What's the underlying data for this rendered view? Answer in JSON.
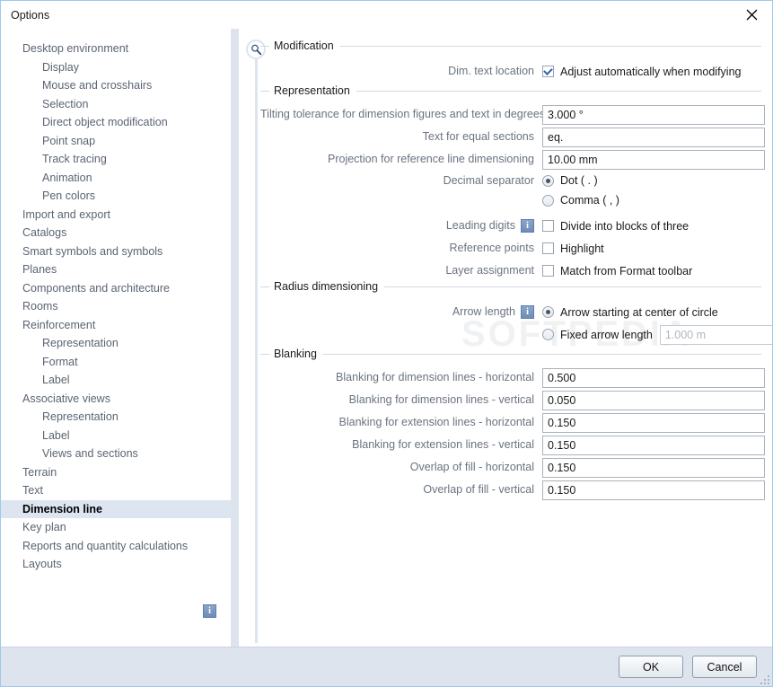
{
  "window": {
    "title": "Options",
    "close_icon": "close-icon"
  },
  "sidebar": {
    "info_icon": "info-icon",
    "items": [
      {
        "label": "Desktop environment",
        "level": 0,
        "selected": false
      },
      {
        "label": "Display",
        "level": 1,
        "selected": false
      },
      {
        "label": "Mouse and crosshairs",
        "level": 1,
        "selected": false
      },
      {
        "label": "Selection",
        "level": 1,
        "selected": false
      },
      {
        "label": "Direct object modification",
        "level": 1,
        "selected": false
      },
      {
        "label": "Point snap",
        "level": 1,
        "selected": false
      },
      {
        "label": "Track tracing",
        "level": 1,
        "selected": false
      },
      {
        "label": "Animation",
        "level": 1,
        "selected": false
      },
      {
        "label": "Pen colors",
        "level": 1,
        "selected": false
      },
      {
        "label": "Import and export",
        "level": 0,
        "selected": false
      },
      {
        "label": "Catalogs",
        "level": 0,
        "selected": false
      },
      {
        "label": "Smart symbols and symbols",
        "level": 0,
        "selected": false
      },
      {
        "label": "Planes",
        "level": 0,
        "selected": false
      },
      {
        "label": "Components and architecture",
        "level": 0,
        "selected": false
      },
      {
        "label": "Rooms",
        "level": 0,
        "selected": false
      },
      {
        "label": "Reinforcement",
        "level": 0,
        "selected": false
      },
      {
        "label": "Representation",
        "level": 1,
        "selected": false
      },
      {
        "label": "Format",
        "level": 1,
        "selected": false
      },
      {
        "label": "Label",
        "level": 1,
        "selected": false
      },
      {
        "label": "Associative views",
        "level": 0,
        "selected": false
      },
      {
        "label": "Representation",
        "level": 1,
        "selected": false
      },
      {
        "label": "Label",
        "level": 1,
        "selected": false
      },
      {
        "label": "Views and sections",
        "level": 1,
        "selected": false
      },
      {
        "label": "Terrain",
        "level": 0,
        "selected": false
      },
      {
        "label": "Text",
        "level": 0,
        "selected": false
      },
      {
        "label": "Dimension line",
        "level": 0,
        "selected": true
      },
      {
        "label": "Key plan",
        "level": 0,
        "selected": false
      },
      {
        "label": "Reports and quantity calculations",
        "level": 0,
        "selected": false
      },
      {
        "label": "Layouts",
        "level": 0,
        "selected": false
      }
    ]
  },
  "content": {
    "watermark": "SOFTPEDIA",
    "magnifier_icon": "magnifier-icon",
    "groups": {
      "modification": {
        "title": "Modification",
        "dim_text_location_label": "Dim. text location",
        "adjust_automatically_label": "Adjust automatically when modifying",
        "adjust_automatically_checked": true
      },
      "representation": {
        "title": "Representation",
        "tilting_label": "Tilting tolerance for dimension figures and text in degrees",
        "tilting_value": "3.000 °",
        "equal_sections_label": "Text for equal sections",
        "equal_sections_value": "eq.",
        "projection_label": "Projection for reference line dimensioning",
        "projection_value": "10.00 mm",
        "decimal_separator_label": "Decimal separator",
        "decimal_dot_label": "Dot ( . )",
        "decimal_comma_label": "Comma ( , )",
        "decimal_selected": "dot",
        "leading_digits_label": "Leading digits",
        "leading_digits_info_icon": "info-icon",
        "divide_blocks_label": "Divide into blocks of three",
        "divide_blocks_checked": false,
        "reference_points_label": "Reference points",
        "highlight_label": "Highlight",
        "highlight_checked": false,
        "layer_assignment_label": "Layer assignment",
        "match_format_label": "Match from Format toolbar",
        "match_format_checked": false
      },
      "radius": {
        "title": "Radius dimensioning",
        "arrow_length_label": "Arrow length",
        "arrow_length_info_icon": "info-icon",
        "arrow_center_label": "Arrow starting at center of circle",
        "fixed_arrow_label": "Fixed arrow length",
        "fixed_arrow_value": "1.000 m",
        "fixed_arrow_disabled": true,
        "arrow_selected": "center"
      },
      "blanking": {
        "title": "Blanking",
        "rows": [
          {
            "label": "Blanking for dimension lines - horizontal",
            "value": "0.500"
          },
          {
            "label": "Blanking for dimension lines - vertical",
            "value": "0.050"
          },
          {
            "label": "Blanking for extension lines - horizontal",
            "value": "0.150"
          },
          {
            "label": "Blanking for extension lines - vertical",
            "value": "0.150"
          },
          {
            "label": "Overlap of fill - horizontal",
            "value": "0.150"
          },
          {
            "label": "Overlap of fill - vertical",
            "value": "0.150"
          }
        ]
      }
    }
  },
  "footer": {
    "ok_label": "OK",
    "cancel_label": "Cancel"
  },
  "colors": {
    "window_border": "#9ecaeb",
    "selection_bg": "#dde5f0",
    "footer_bg": "#dde4ee",
    "label_text": "#6a7380",
    "accent": "#2a62b0"
  }
}
